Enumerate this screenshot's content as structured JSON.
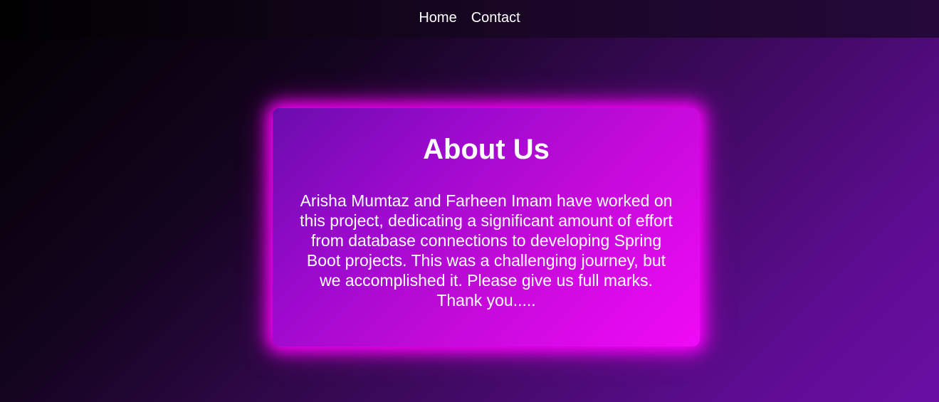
{
  "nav": {
    "home_label": "Home",
    "contact_label": "Contact"
  },
  "about": {
    "title": "About Us",
    "body": "Arisha Mumtaz and Farheen Imam have worked on this project, dedicating a significant amount of effort from database connections to developing Spring Boot projects. This was a challenging journey, but we accomplished it. Please give us full marks. Thank you....."
  },
  "colors": {
    "glow": "#ff00ff",
    "card_start": "#6a0cad",
    "card_end": "#f00af5",
    "background_end": "#6a0ea3"
  }
}
